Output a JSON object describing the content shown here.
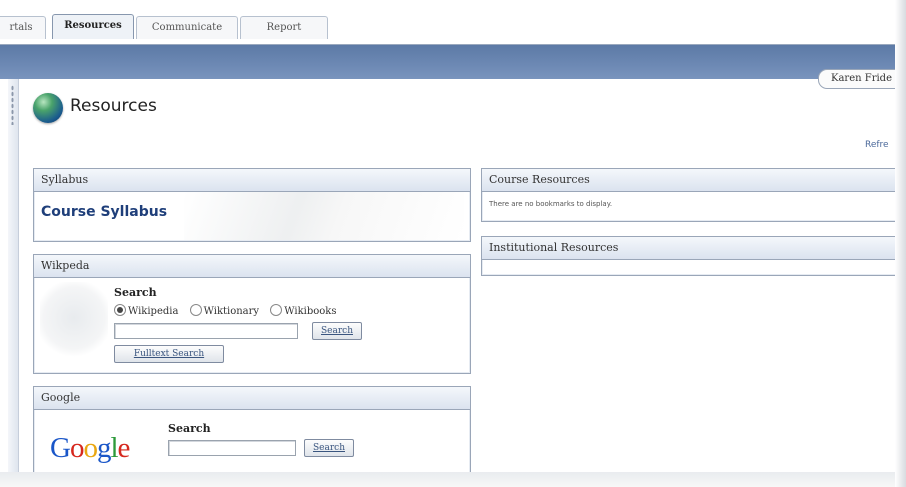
{
  "tabs": [
    {
      "label": "rtals",
      "active": false
    },
    {
      "label": "Resources",
      "active": true
    },
    {
      "label": "Communicate",
      "active": false
    },
    {
      "label": "Report",
      "active": false
    }
  ],
  "user": {
    "name": "Karen Fride"
  },
  "page": {
    "title": "Resources",
    "icon": "globe-icon",
    "refresh_label": "Refre"
  },
  "syllabus": {
    "title": "Syllabus",
    "link": "Course Syllabus"
  },
  "wikipedia": {
    "title": "Wikpeda",
    "search_label": "Search",
    "options": [
      {
        "label": "Wikipedia",
        "selected": true
      },
      {
        "label": "Wiktionary",
        "selected": false
      },
      {
        "label": "Wikibooks",
        "selected": false
      }
    ],
    "search_value": "",
    "search_button": "Search",
    "fulltext_button": "Fulltext Search"
  },
  "google": {
    "title": "Google",
    "logo_text": "Google",
    "search_label": "Search",
    "search_value": "",
    "search_button": "Search"
  },
  "course_resources": {
    "title": "Course Resources",
    "message": "There are no bookmarks to display."
  },
  "institutional_resources": {
    "title": "Institutional Resources"
  },
  "colors": {
    "banner": "#6d89b4",
    "link": "#1f3f7a",
    "header_bg": "#dbe3ef"
  }
}
